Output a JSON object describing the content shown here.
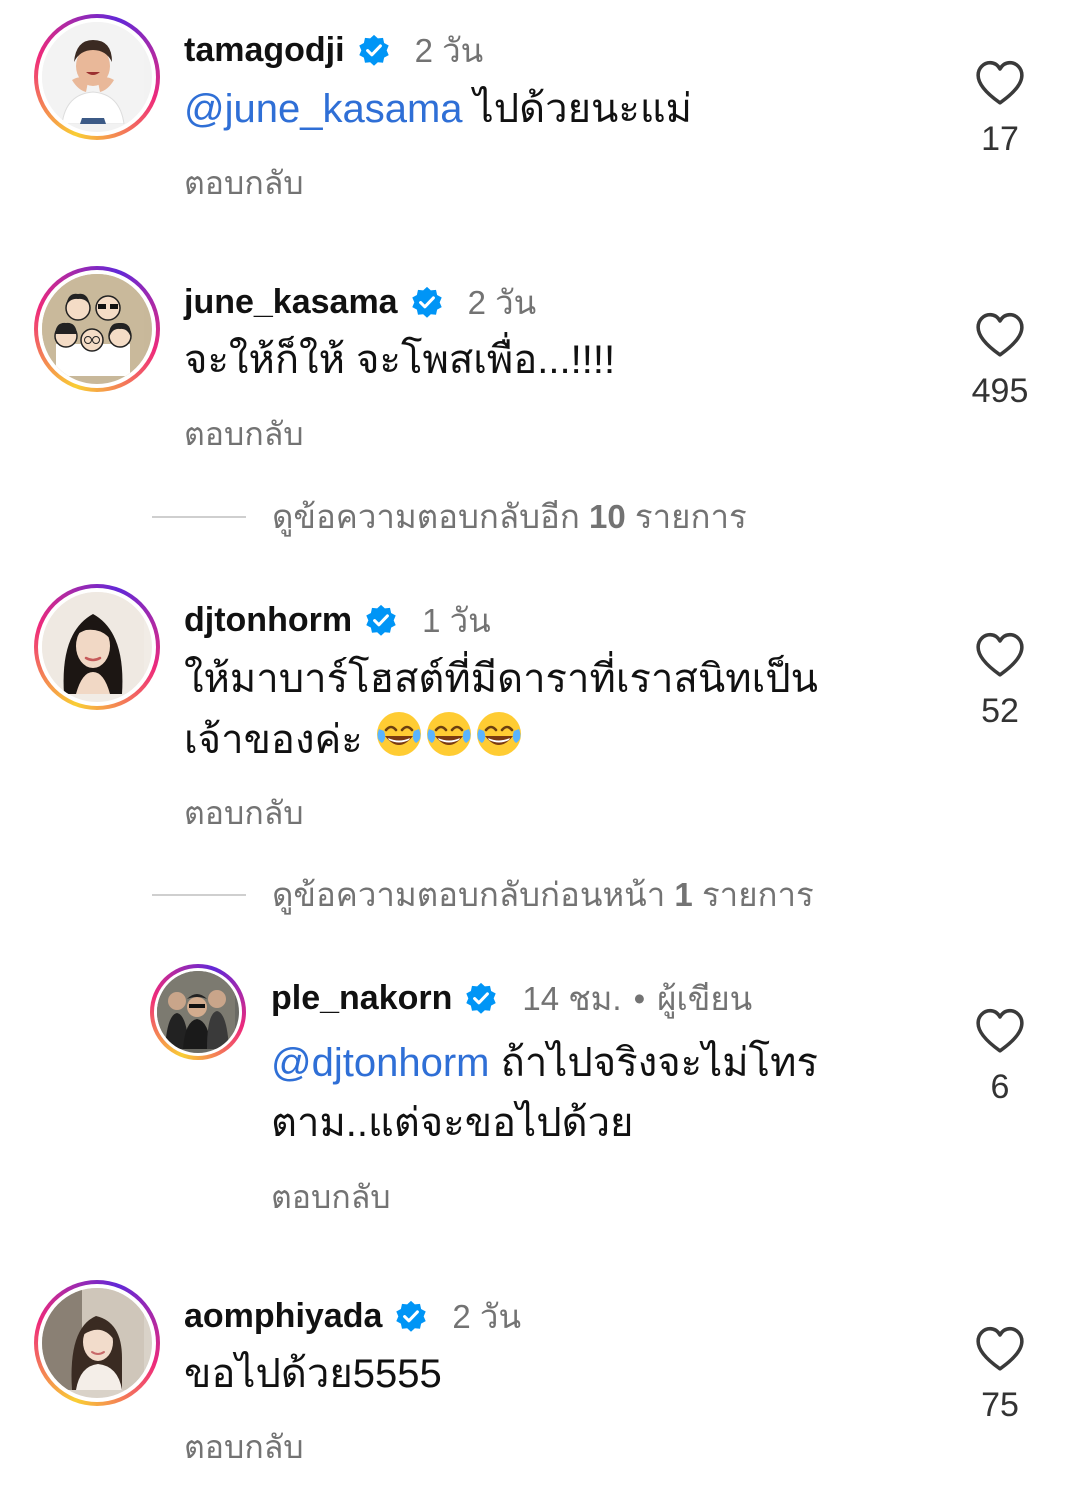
{
  "comments": [
    {
      "username": "tamagodji",
      "time": "2 วัน",
      "mention": "@june_kasama",
      "text": " ไปด้วยนะแม่",
      "reply_label": "ตอบกลับ",
      "likes": "17"
    },
    {
      "username": "june_kasama",
      "time": "2 วัน",
      "text": "จะให้ก็ให้ จะโพสเพื่อ...!!!!",
      "reply_label": "ตอบกลับ",
      "likes": "495"
    },
    {
      "username": "djtonhorm",
      "time": "1 วัน",
      "text_line1": "ให้มาบาร์โฮสต์ที่มีดาราที่เราสนิทเป็น",
      "text_line2": "เจ้าของค่ะ ",
      "emoji": "face-with-tears-of-joy",
      "reply_label": "ตอบกลับ",
      "likes": "52"
    },
    {
      "username": "ple_nakorn",
      "time": "14 ชม.",
      "dot": "•",
      "author_label": "ผู้เขียน",
      "mention": "@djtonhorm",
      "text_line1": " ถ้าไปจริงจะไม่โทร",
      "text_line2": "ตาม..แต่จะขอไปด้วย",
      "reply_label": "ตอบกลับ",
      "likes": "6"
    },
    {
      "username": "aomphiyada",
      "time": "2 วัน",
      "text": "ขอไปด้วย5555",
      "reply_label": "ตอบกลับ",
      "likes": "75"
    }
  ],
  "view_more_replies": {
    "prefix": "ดูข้อความตอบกลับอีก ",
    "count": "10",
    "suffix": " รายการ"
  },
  "view_previous_replies": {
    "prefix": "ดูข้อความตอบกลับก่อนหน้า ",
    "count": "1",
    "suffix": " รายการ"
  },
  "colors": {
    "mention": "#2f6fd6",
    "secondary_text": "#737373",
    "verified": "#0095f6"
  },
  "icons": {
    "like": "heart-outline-icon",
    "verified": "verified-badge-icon"
  }
}
